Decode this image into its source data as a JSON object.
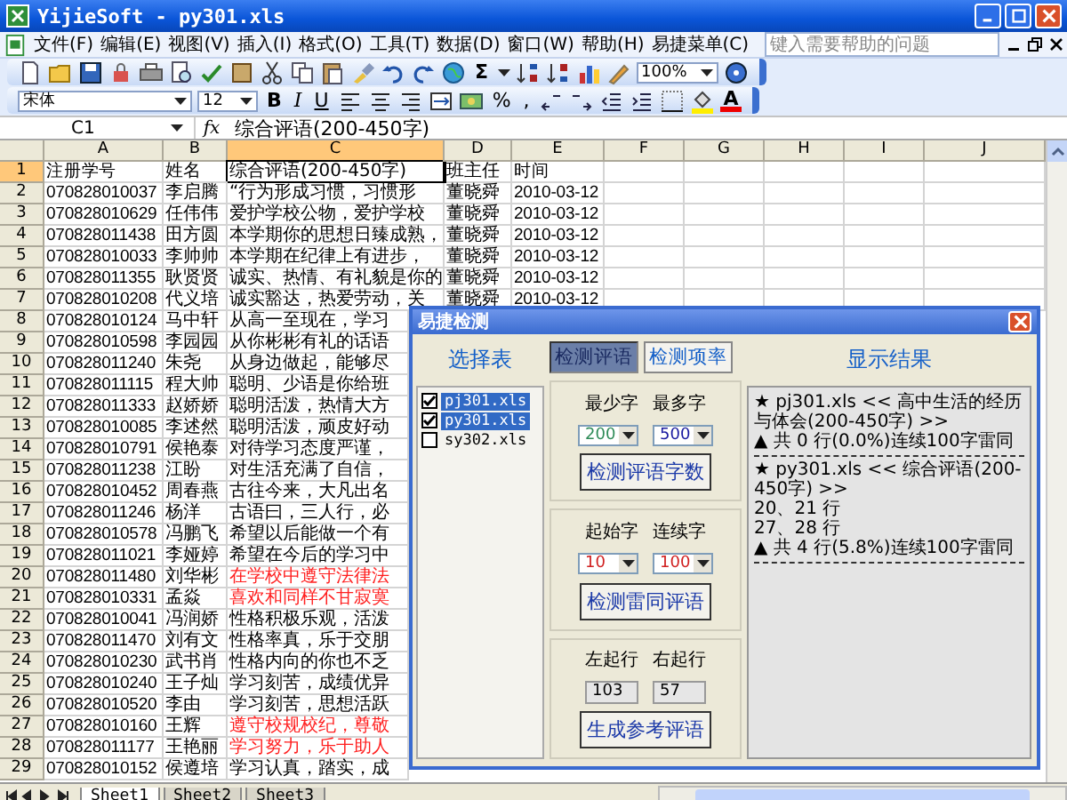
{
  "window": {
    "title": "YijieSoft - py301.xls"
  },
  "menu": [
    "文件(F)",
    "编辑(E)",
    "视图(V)",
    "插入(I)",
    "格式(O)",
    "工具(T)",
    "数据(D)",
    "窗口(W)",
    "帮助(H)",
    "易捷菜单(C)"
  ],
  "help_box": {
    "placeholder": "键入需要帮助的问题"
  },
  "toolbar": {
    "sum": "Σ",
    "zoom": "100%"
  },
  "format_bar": {
    "font": "宋体",
    "size": "12",
    "bold": "B",
    "italic": "I",
    "underline": "U",
    "percent": "%",
    "comma": ",",
    "font_color": "A"
  },
  "formula_bar": {
    "cell": "C1",
    "fx": "fx",
    "value": "综合评语(200-450字)"
  },
  "columns": [
    {
      "label": "A",
      "selected": false
    },
    {
      "label": "B",
      "selected": false
    },
    {
      "label": "C",
      "selected": true
    },
    {
      "label": "D",
      "selected": false
    },
    {
      "label": "E",
      "selected": false
    },
    {
      "label": "F",
      "selected": false
    },
    {
      "label": "G",
      "selected": false
    },
    {
      "label": "H",
      "selected": false
    },
    {
      "label": "I",
      "selected": false
    },
    {
      "label": "J",
      "selected": false
    }
  ],
  "rows": [
    {
      "num": "1",
      "id": "注册学号",
      "name": "姓名",
      "comment": "综合评语(200-450字)",
      "teacher": "班主任",
      "date": "时间",
      "flagged": false,
      "active": true
    },
    {
      "num": "2",
      "id": "070828010037",
      "name": "李启腾",
      "comment": "“行为形成习惯，习惯形",
      "teacher": "董晓舜",
      "date": "2010-03-12",
      "flagged": false,
      "active": false
    },
    {
      "num": "3",
      "id": "070828010629",
      "name": "任伟伟",
      "comment": "爱护学校公物，爱护学校",
      "teacher": "董晓舜",
      "date": "2010-03-12",
      "flagged": false,
      "active": false
    },
    {
      "num": "4",
      "id": "070828011438",
      "name": "田方圆",
      "comment": "本学期你的思想日臻成熟，",
      "teacher": "董晓舜",
      "date": "2010-03-12",
      "flagged": false,
      "active": false
    },
    {
      "num": "5",
      "id": "070828010033",
      "name": "李帅帅",
      "comment": "本学期在纪律上有进步，",
      "teacher": "董晓舜",
      "date": "2010-03-12",
      "flagged": false,
      "active": false
    },
    {
      "num": "6",
      "id": "070828011355",
      "name": "耿贤贤",
      "comment": "诚实、热情、有礼貌是你的",
      "teacher": "董晓舜",
      "date": "2010-03-12",
      "flagged": false,
      "active": false
    },
    {
      "num": "7",
      "id": "070828010208",
      "name": "代义培",
      "comment": "诚实豁达，热爱劳动，关",
      "teacher": "董晓舜",
      "date": "2010-03-12",
      "flagged": false,
      "active": false
    },
    {
      "num": "8",
      "id": "070828010124",
      "name": "马中轩",
      "comment": "从高一至现在，学习",
      "flagged": false,
      "active": false
    },
    {
      "num": "9",
      "id": "070828010598",
      "name": "李园园",
      "comment": "从你彬彬有礼的话语",
      "flagged": false,
      "active": false
    },
    {
      "num": "10",
      "id": "070828011240",
      "name": "朱尧",
      "comment": "从身边做起，能够尽",
      "flagged": false,
      "active": false
    },
    {
      "num": "11",
      "id": "070828011115",
      "name": "程大帅",
      "comment": "聪明、少语是你给班",
      "flagged": false,
      "active": false
    },
    {
      "num": "12",
      "id": "070828011333",
      "name": "赵娇娇",
      "comment": "聪明活泼，热情大方",
      "flagged": false,
      "active": false
    },
    {
      "num": "13",
      "id": "070828010085",
      "name": "李述然",
      "comment": "聪明活泼，顽皮好动",
      "flagged": false,
      "active": false
    },
    {
      "num": "14",
      "id": "070828010791",
      "name": "侯艳泰",
      "comment": "对待学习态度严谨，",
      "flagged": false,
      "active": false
    },
    {
      "num": "15",
      "id": "070828011238",
      "name": "江盼",
      "comment": "对生活充满了自信，",
      "flagged": false,
      "active": false
    },
    {
      "num": "16",
      "id": "070828010452",
      "name": "周春燕",
      "comment": "古往今来，大凡出名",
      "flagged": false,
      "active": false
    },
    {
      "num": "17",
      "id": "070828011246",
      "name": "杨洋",
      "comment": "古语曰，三人行，必",
      "flagged": false,
      "active": false
    },
    {
      "num": "18",
      "id": "070828010578",
      "name": "冯鹏飞",
      "comment": "希望以后能做一个有",
      "flagged": false,
      "active": false
    },
    {
      "num": "19",
      "id": "070828011021",
      "name": "李娅婷",
      "comment": "希望在今后的学习中",
      "flagged": false,
      "active": false
    },
    {
      "num": "20",
      "id": "070828011480",
      "name": "刘华彬",
      "comment": "在学校中遵守法律法",
      "flagged": true,
      "active": false
    },
    {
      "num": "21",
      "id": "070828010331",
      "name": "孟焱",
      "comment": "喜欢和同样不甘寂寞",
      "flagged": true,
      "active": false
    },
    {
      "num": "22",
      "id": "070828010041",
      "name": "冯润娇",
      "comment": "性格积极乐观，活泼",
      "flagged": false,
      "active": false
    },
    {
      "num": "23",
      "id": "070828011470",
      "name": "刘有文",
      "comment": "性格率真，乐于交朋",
      "flagged": false,
      "active": false
    },
    {
      "num": "24",
      "id": "070828010230",
      "name": "武书肖",
      "comment": "性格内向的你也不乏",
      "flagged": false,
      "active": false
    },
    {
      "num": "25",
      "id": "070828010240",
      "name": "王子灿",
      "comment": "学习刻苦，成绩优异",
      "flagged": false,
      "active": false
    },
    {
      "num": "26",
      "id": "070828010520",
      "name": "李由",
      "comment": "学习刻苦，思想活跃",
      "flagged": false,
      "active": false
    },
    {
      "num": "27",
      "id": "070828010160",
      "name": "王辉",
      "comment": "遵守校规校纪，尊敬",
      "flagged": true,
      "active": false
    },
    {
      "num": "28",
      "id": "070828011177",
      "name": "王艳丽",
      "comment": "学习努力，乐于助人",
      "flagged": true,
      "active": false
    },
    {
      "num": "29",
      "id": "070828010152",
      "name": "侯遵培",
      "comment": "学习认真，踏实，成",
      "flagged": false,
      "active": false
    }
  ],
  "sheet_tabs": [
    {
      "label": "Sheet1",
      "selected": true
    },
    {
      "label": "Sheet2",
      "selected": false
    },
    {
      "label": "Sheet3",
      "selected": false
    }
  ],
  "dialog": {
    "title": "易捷检测",
    "tables_heading": "选择表",
    "tables": [
      {
        "label": "pj301.xls",
        "checked": true,
        "selected": true
      },
      {
        "label": "py301.xls",
        "checked": true,
        "selected": true
      },
      {
        "label": "sy302.xls",
        "checked": false,
        "selected": false
      }
    ],
    "tabs": [
      {
        "label": "检测评语",
        "selected": true
      },
      {
        "label": "检测项率",
        "selected": false
      }
    ],
    "groups": [
      {
        "kind": "dropdown",
        "labels": [
          "最少字",
          "最多字"
        ],
        "values": [
          {
            "text": "200",
            "color": "#2e8b57"
          },
          {
            "text": "500",
            "color": "#1a1aa0"
          }
        ],
        "button": "检测评语字数"
      },
      {
        "kind": "dropdown",
        "labels": [
          "起始字",
          "连续字"
        ],
        "values": [
          {
            "text": "10",
            "color": "#d02020"
          },
          {
            "text": "100",
            "color": "#d02020"
          }
        ],
        "button": "检测雷同评语"
      },
      {
        "kind": "field",
        "labels": [
          "左起行",
          "右起行"
        ],
        "values": [
          {
            "text": "103"
          },
          {
            "text": "57"
          }
        ],
        "button": "生成参考评语"
      }
    ],
    "results_heading": "显示结果",
    "results": [
      {
        "kind": "text",
        "text": "★ pj301.xls << 高中生活的经历与体会(200-450字) >>"
      },
      {
        "kind": "text",
        "text": "▲ 共 0 行(0.0%)连续100字雷同"
      },
      {
        "kind": "rule"
      },
      {
        "kind": "text",
        "text": "★ py301.xls << 综合评语(200-450字) >>"
      },
      {
        "kind": "text",
        "text": "20、21 行"
      },
      {
        "kind": "text",
        "text": "27、28 行"
      },
      {
        "kind": "text",
        "text": "▲ 共 4 行(5.8%)连续100字雷同"
      },
      {
        "kind": "rule"
      }
    ]
  }
}
